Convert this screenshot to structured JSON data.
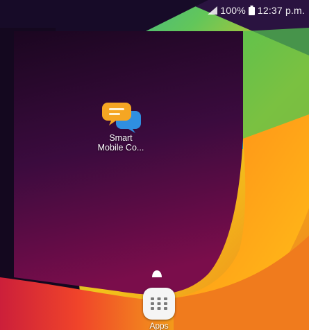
{
  "status_bar": {
    "battery_percent": "100%",
    "time": "12:37 p.m.",
    "icons": [
      "signal-icon",
      "battery-icon"
    ]
  },
  "home": {
    "shortcut": {
      "icon": "chat-bubbles-icon",
      "label_line1": "Smart",
      "label_line2": "Mobile Co..."
    },
    "apps_button": {
      "icon": "app-grid-icon",
      "label": "Apps"
    },
    "page_indicator_icon": "home-page-icon"
  },
  "colors": {
    "deep_purple": "#1a0a2a",
    "teal": "#19b6c6",
    "orange": "#f39a1a",
    "yellow": "#f4d21a",
    "red": "#e4362a",
    "green": "#7bcf45",
    "apps_tile": "#f5f5f5"
  }
}
